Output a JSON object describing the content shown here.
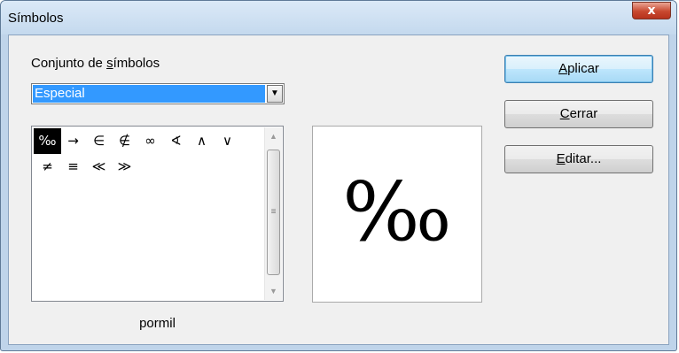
{
  "window": {
    "title": "Símbolos",
    "close_glyph": "x"
  },
  "symbol_set": {
    "label_pre": "Conjunto de ",
    "label_mnemonic": "s",
    "label_post": "ímbolos",
    "selected": "Especial",
    "arrow": "▼"
  },
  "symbols": [
    "‰",
    "→",
    "∈",
    "∉",
    "∞",
    "∢",
    "∧",
    "∨",
    "≠",
    "≡",
    "≪",
    "≫"
  ],
  "selected_index": 0,
  "scrollbar": {
    "up": "▲",
    "down": "▼",
    "grip": "≡"
  },
  "symbol_name": "pormil",
  "preview_symbol": "‰",
  "buttons": {
    "apply": {
      "mnemonic": "A",
      "rest": "plicar"
    },
    "close": {
      "mnemonic": "C",
      "rest": "errar"
    },
    "edit": {
      "mnemonic": "E",
      "rest": "ditar..."
    }
  }
}
